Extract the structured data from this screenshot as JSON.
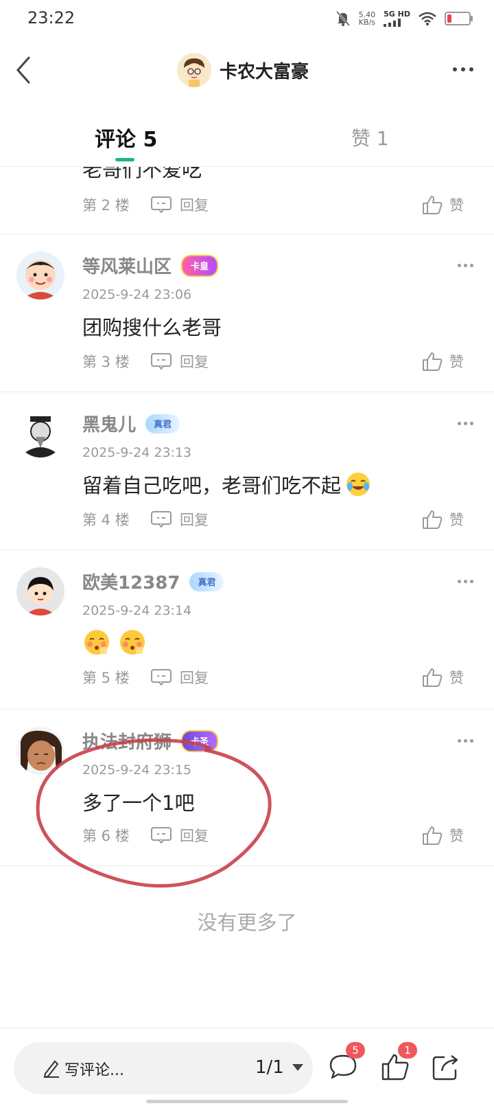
{
  "status_bar": {
    "time": "23:22",
    "speed": "5.40",
    "speed_unit": "KB/s",
    "network": "5G HD",
    "battery_percent": 20
  },
  "header": {
    "owner_name": "卡农大富豪"
  },
  "tabs": {
    "comments": "评论 5",
    "likes": "赞 1"
  },
  "partial_comment": {
    "text": "老哥们不爱吃",
    "floor": "第 2 楼",
    "reply": "回复",
    "like": "赞"
  },
  "comments": [
    {
      "name": "等风莱山区",
      "badge": "卡皇",
      "time": "2025-9-24 23:06",
      "text": "团购搜什么老哥",
      "floor": "第 3 楼",
      "reply": "回复",
      "like": "赞"
    },
    {
      "name": "黑鬼儿",
      "badge": "真君",
      "time": "2025-9-24 23:13",
      "text": "留着自己吃吧，老哥们吃不起",
      "floor": "第 4 楼",
      "reply": "回复",
      "like": "赞"
    },
    {
      "name": "欧美12387",
      "badge": "真君",
      "time": "2025-9-24 23:14",
      "text": "",
      "floor": "第 5 楼",
      "reply": "回复",
      "like": "赞"
    },
    {
      "name": "执法封府狮",
      "badge": "卡圣",
      "time": "2025-9-24 23:15",
      "text": "多了一个1吧",
      "floor": "第 6 楼",
      "reply": "回复",
      "like": "赞"
    }
  ],
  "no_more": "没有更多了",
  "bottom_bar": {
    "write_placeholder": "写评论...",
    "page_indicator": "1/1",
    "comment_count": "5",
    "like_count": "1"
  },
  "colors": {
    "accent": "#1cb48f",
    "badge_red": "#f0585c",
    "annotation": "#c8404a"
  }
}
